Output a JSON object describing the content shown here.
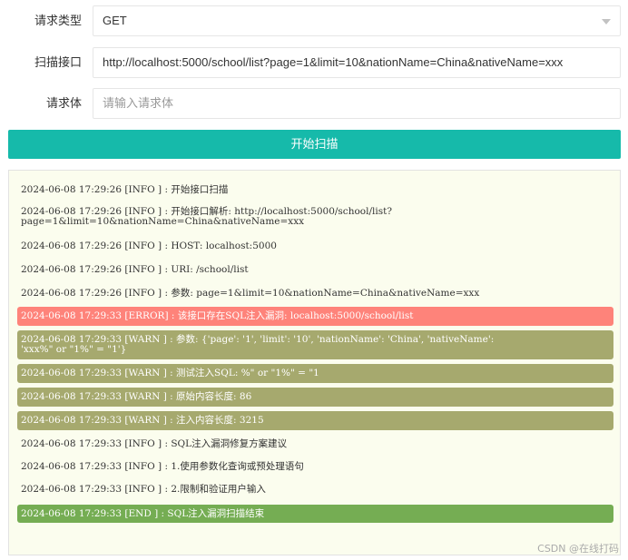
{
  "form": {
    "method_label": "请求类型",
    "method_value": "GET",
    "url_label": "扫描接口",
    "url_value": "http://localhost:5000/school/list?page=1&limit=10&nationName=China&nativeName=xxx",
    "body_label": "请求体",
    "body_placeholder": "请输入请求体",
    "scan_button_label": "开始扫描"
  },
  "log": {
    "entries": [
      {
        "level": "info",
        "text": "2024-06-08 17:29:26 [INFO ] : 开始接口扫描"
      },
      {
        "level": "info",
        "text": "2024-06-08 17:29:26 [INFO ] : 开始接口解析: http://localhost:5000/school/list?\npage=1&limit=10&nationName=China&nativeName=xxx"
      },
      {
        "level": "info",
        "text": "2024-06-08 17:29:26 [INFO ] : HOST: localhost:5000"
      },
      {
        "level": "info",
        "text": "2024-06-08 17:29:26 [INFO ] : URI: /school/list"
      },
      {
        "level": "info",
        "text": "2024-06-08 17:29:26 [INFO ] : 参数: page=1&limit=10&nationName=China&nativeName=xxx"
      },
      {
        "level": "error",
        "text": "2024-06-08 17:29:33 [ERROR] : 该接口存在SQL注入漏洞: localhost:5000/school/list"
      },
      {
        "level": "warn",
        "text": "2024-06-08 17:29:33 [WARN ] : 参数: {'page': '1', 'limit': '10', 'nationName': 'China', 'nativeName':\n'xxx%\" or \"1%\" = \"1'}"
      },
      {
        "level": "warn",
        "text": "2024-06-08 17:29:33 [WARN ] : 测试注入SQL: %\" or \"1%\" = \"1"
      },
      {
        "level": "warn",
        "text": "2024-06-08 17:29:33 [WARN ] : 原始内容长度: 86"
      },
      {
        "level": "warn",
        "text": "2024-06-08 17:29:33 [WARN ] : 注入内容长度: 3215"
      },
      {
        "level": "info",
        "text": "2024-06-08 17:29:33 [INFO ] : SQL注入漏洞修复方案建议"
      },
      {
        "level": "info",
        "text": "2024-06-08 17:29:33 [INFO ] : 1.使用参数化查询或预处理语句"
      },
      {
        "level": "info",
        "text": "2024-06-08 17:29:33 [INFO ] : 2.限制和验证用户输入"
      },
      {
        "level": "end",
        "text": "2024-06-08 17:29:33 [END ] : SQL注入漏洞扫描结束"
      }
    ]
  },
  "watermark": "CSDN @在线打码",
  "colors": {
    "accent": "#16baaa",
    "error_bg": "#fe837a",
    "warn_bg": "#a6a96e",
    "end_bg": "#75ad53",
    "log_bg": "#fbfdee"
  }
}
